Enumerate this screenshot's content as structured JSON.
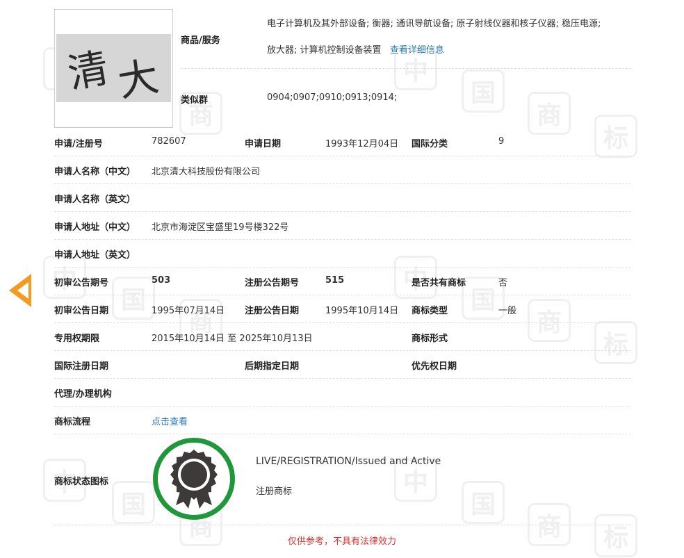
{
  "colors": {
    "accent_arrow": "#f39a21",
    "link": "#2a7ab8",
    "status_green": "#20973b",
    "disclaimer_red": "#e0302a"
  },
  "trademark_image": {
    "chars": [
      "清",
      "大"
    ]
  },
  "goods": {
    "label": "商品/服务",
    "line1": "电子计算机及其外部设备; 衡器; 通讯导航设备; 原子射线仪器和核子仪器; 稳压电源;",
    "line2": "放大器; 计算机控制设备装置",
    "detail_link": "查看详细信息"
  },
  "similar_group": {
    "label": "类似群",
    "value": "0904;0907;0910;0913;0914;"
  },
  "reg_no": {
    "label": "申请/注册号",
    "value": "782607"
  },
  "apply_date": {
    "label": "申请日期",
    "value": "1993年12月04日"
  },
  "intl_class": {
    "label": "国际分类",
    "value": "9"
  },
  "applicant_cn": {
    "label": "申请人名称（中文）",
    "value": "北京清大科技股份有限公司"
  },
  "applicant_en": {
    "label": "申请人名称（英文）",
    "value": ""
  },
  "address_cn": {
    "label": "申请人地址（中文）",
    "value": "北京市海淀区宝盛里19号楼322号"
  },
  "address_en": {
    "label": "申请人地址（英文）",
    "value": ""
  },
  "prelim_no": {
    "label": "初审公告期号",
    "value": "503"
  },
  "reg_pub_no": {
    "label": "注册公告期号",
    "value": "515"
  },
  "shared": {
    "label": "是否共有商标",
    "value": "否"
  },
  "prelim_date": {
    "label": "初审公告日期",
    "value": "1995年07月14日"
  },
  "reg_pub_date": {
    "label": "注册公告日期",
    "value": "1995年10月14日"
  },
  "tm_type": {
    "label": "商标类型",
    "value": "一般"
  },
  "exclusive": {
    "label": "专用权期限",
    "value": "2015年10月14日 至 2025年10月13日"
  },
  "tm_form": {
    "label": "商标形式",
    "value": ""
  },
  "intl_reg_date": {
    "label": "国际注册日期",
    "value": ""
  },
  "later_date": {
    "label": "后期指定日期",
    "value": ""
  },
  "priority_date": {
    "label": "优先权日期",
    "value": ""
  },
  "agency": {
    "label": "代理/办理机构",
    "value": ""
  },
  "flow": {
    "label": "商标流程",
    "link": "点击查看"
  },
  "status": {
    "label": "商标状态图标",
    "line1": "LIVE/REGISTRATION/Issued and Active",
    "line2": "注册商标"
  },
  "disclaimer": "仅供参考，不具有法律效力",
  "watermark": [
    "中",
    "国",
    "商",
    "标"
  ]
}
